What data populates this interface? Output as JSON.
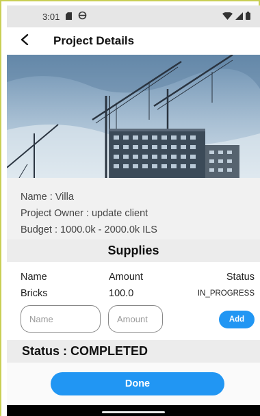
{
  "status_bar": {
    "time": "3:01",
    "left_icons": [
      "sim-card-icon",
      "vpn-icon"
    ],
    "right_icons": [
      "wifi-icon",
      "signal-icon",
      "battery-icon"
    ]
  },
  "app_bar": {
    "back_icon": "back-arrow-icon",
    "title": "Project Details"
  },
  "hero": {
    "icon": "construction-site-image"
  },
  "project_info": {
    "name_line": "Name : Villa",
    "owner_line": "Project Owner : update client",
    "budget_line": "Budget : 1000.0k - 2000.0k ILS"
  },
  "supplies": {
    "title": "Supplies",
    "headers": {
      "name": "Name",
      "amount": "Amount",
      "status": "Status"
    },
    "rows": [
      {
        "name": "Bricks",
        "amount": "100.0",
        "status": "IN_PROGRESS"
      }
    ],
    "form": {
      "name_placeholder": "Name",
      "amount_placeholder": "Amount",
      "add_label": "Add"
    }
  },
  "project_status": {
    "text": "Status : COMPLETED"
  },
  "footer": {
    "done_label": "Done"
  },
  "colors": {
    "accent": "#2196f3",
    "section_bg": "#ececec",
    "info_bg": "#f1f1f1"
  }
}
